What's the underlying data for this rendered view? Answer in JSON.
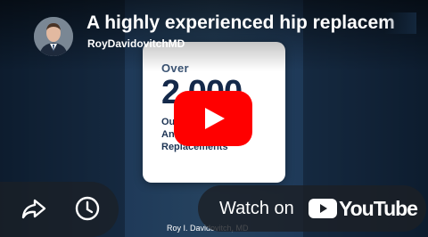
{
  "video": {
    "title": "A highly experienced hip replacem",
    "channel": "RoyDavidovitchMD"
  },
  "card": {
    "over": "Over",
    "big_number": "2,000",
    "line1": "Ou",
    "line2": "Ant",
    "line3": "Replacements"
  },
  "caption": "Roy I. Davidovitch, MD",
  "controls": {
    "play_icon": "play-icon",
    "share_icon": "share-icon",
    "watch_later_icon": "clock-icon",
    "watch_on": "Watch on",
    "brand": "YouTube"
  },
  "colors": {
    "play_red": "#ff0000",
    "card_text": "#14294a",
    "background": "#1f3a59"
  }
}
